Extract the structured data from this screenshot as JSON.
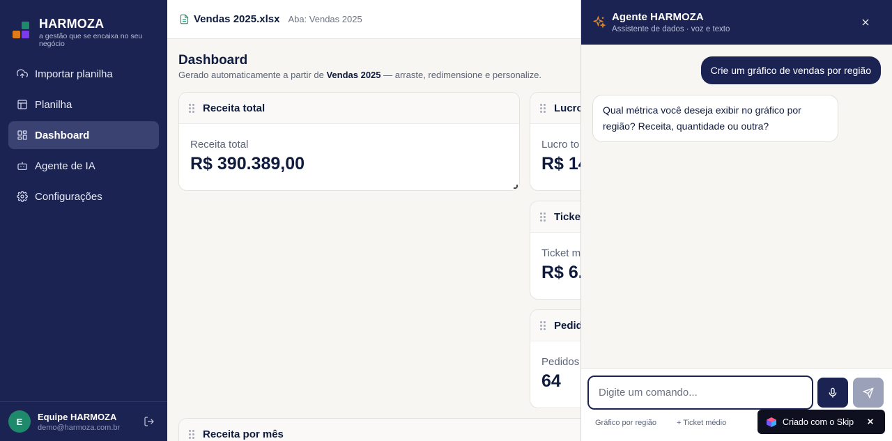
{
  "brand": {
    "name": "HARMOZA",
    "tagline": "a gestão que se encaixa no seu negócio"
  },
  "nav": [
    {
      "label": "Importar planilha",
      "icon": "upload-cloud-icon"
    },
    {
      "label": "Planilha",
      "icon": "table-icon"
    },
    {
      "label": "Dashboard",
      "icon": "layout-grid-icon",
      "active": true
    },
    {
      "label": "Agente de IA",
      "icon": "bot-icon"
    },
    {
      "label": "Configurações",
      "icon": "gear-icon"
    }
  ],
  "user": {
    "initial": "E",
    "name": "Equipe HARMOZA",
    "email": "demo@harmoza.com.br"
  },
  "topbar": {
    "file": "Vendas 2025.xlsx",
    "sheet": "Aba: Vendas 2025"
  },
  "dashboard": {
    "title": "Dashboard",
    "subtitle_pre": "Gerado automaticamente a partir de ",
    "subtitle_bold": "Vendas 2025",
    "subtitle_post": " — arraste, redimensione e personalize.",
    "cards": {
      "receita": {
        "title": "Receita total",
        "label": "Receita total",
        "value": "R$ 390.389,00"
      },
      "lucro": {
        "title": "Lucro",
        "label": "Lucro to",
        "value": "R$ 14"
      },
      "ticket": {
        "title": "Ticket",
        "label": "Ticket m",
        "value": "R$ 6."
      },
      "pedidos": {
        "title": "Pedid",
        "label": "Pedidos",
        "value": "64"
      },
      "receita_mes": {
        "title": "Receita por mês"
      }
    }
  },
  "agent": {
    "title": "Agente HARMOZA",
    "subtitle": "Assistente de dados · voz e texto",
    "messages": {
      "user": "Crie um gráfico de vendas por região",
      "bot": "Qual métrica você deseja exibir no gráfico por região? Receita, quantidade ou outra?"
    },
    "input_placeholder": "Digite um comando...",
    "suggestions": [
      "Gráfico por região",
      "+ Ticket médio"
    ]
  },
  "skip_badge": "Criado com o Skip",
  "colors": {
    "navy": "#1b2352",
    "green": "#1f8a6b",
    "orange": "#e07b1a",
    "purple": "#7c3aed"
  }
}
